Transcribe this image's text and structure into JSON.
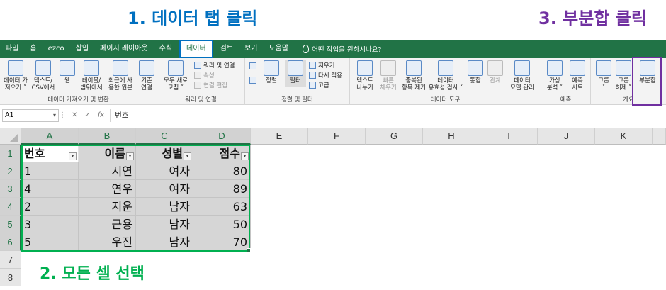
{
  "annotations": {
    "step1": "1. 데이터 탭 클릭",
    "step2": "2. 모든 셀 선택",
    "step3": "3. 부분합 클릭"
  },
  "menu": {
    "tabs": [
      "파일",
      "홈",
      "ezco",
      "삽입",
      "페이지 레이아웃",
      "수식",
      "데이터",
      "검토",
      "보기",
      "도움말"
    ],
    "active_tab": "데이터",
    "tell_me": "어떤 작업을 원하시나요?"
  },
  "ribbon": {
    "groups": {
      "get_data": {
        "title": "데이터 가져오기 및 변환",
        "buttons": [
          "데이터 가\n져오기 ˅",
          "텍스트/\nCSV에서",
          "웹",
          "테이블/\n범위에서",
          "최근에 사\n용한 원본",
          "기존\n연결"
        ]
      },
      "queries": {
        "title": "쿼리 및 연결",
        "refresh_all": "모두 새로\n고침 ˅",
        "queries_connections": "쿼리 및 연결",
        "properties": "속성",
        "edit_links": "연결 편집"
      },
      "sort_filter": {
        "title": "정렬 및 필터",
        "sort": "정렬",
        "filter": "필터",
        "clear": "지우기",
        "reapply": "다시 적용",
        "advanced": "고급"
      },
      "data_tools": {
        "title": "데이터 도구",
        "buttons": [
          "텍스트\n나누기",
          "빠른\n채우기",
          "중복된\n항목 제거",
          "데이터\n유효성 검사 ˅",
          "통합",
          "관계",
          "데이터\n모델 관리"
        ]
      },
      "forecast": {
        "title": "예측",
        "buttons": [
          "가상\n분석 ˅",
          "예측\n시트"
        ]
      },
      "outline": {
        "title": "개요",
        "buttons": [
          "그룹\n˅",
          "그룹\n해제 ˅",
          "부분합"
        ]
      }
    }
  },
  "formula_bar": {
    "name_box": "A1",
    "fx": "fx",
    "content": "번호"
  },
  "sheet": {
    "columns": [
      "A",
      "B",
      "C",
      "D",
      "E",
      "F",
      "G",
      "H",
      "I",
      "J",
      "K"
    ],
    "rows": [
      "1",
      "2",
      "3",
      "4",
      "5",
      "6",
      "7",
      "8"
    ],
    "header": [
      "번호",
      "이름",
      "성별",
      "점수"
    ],
    "data": [
      [
        "1",
        "시연",
        "여자",
        "80"
      ],
      [
        "4",
        "연우",
        "여자",
        "89"
      ],
      [
        "2",
        "지운",
        "남자",
        "63"
      ],
      [
        "3",
        "근용",
        "남자",
        "50"
      ],
      [
        "5",
        "우진",
        "남자",
        "70"
      ]
    ]
  }
}
